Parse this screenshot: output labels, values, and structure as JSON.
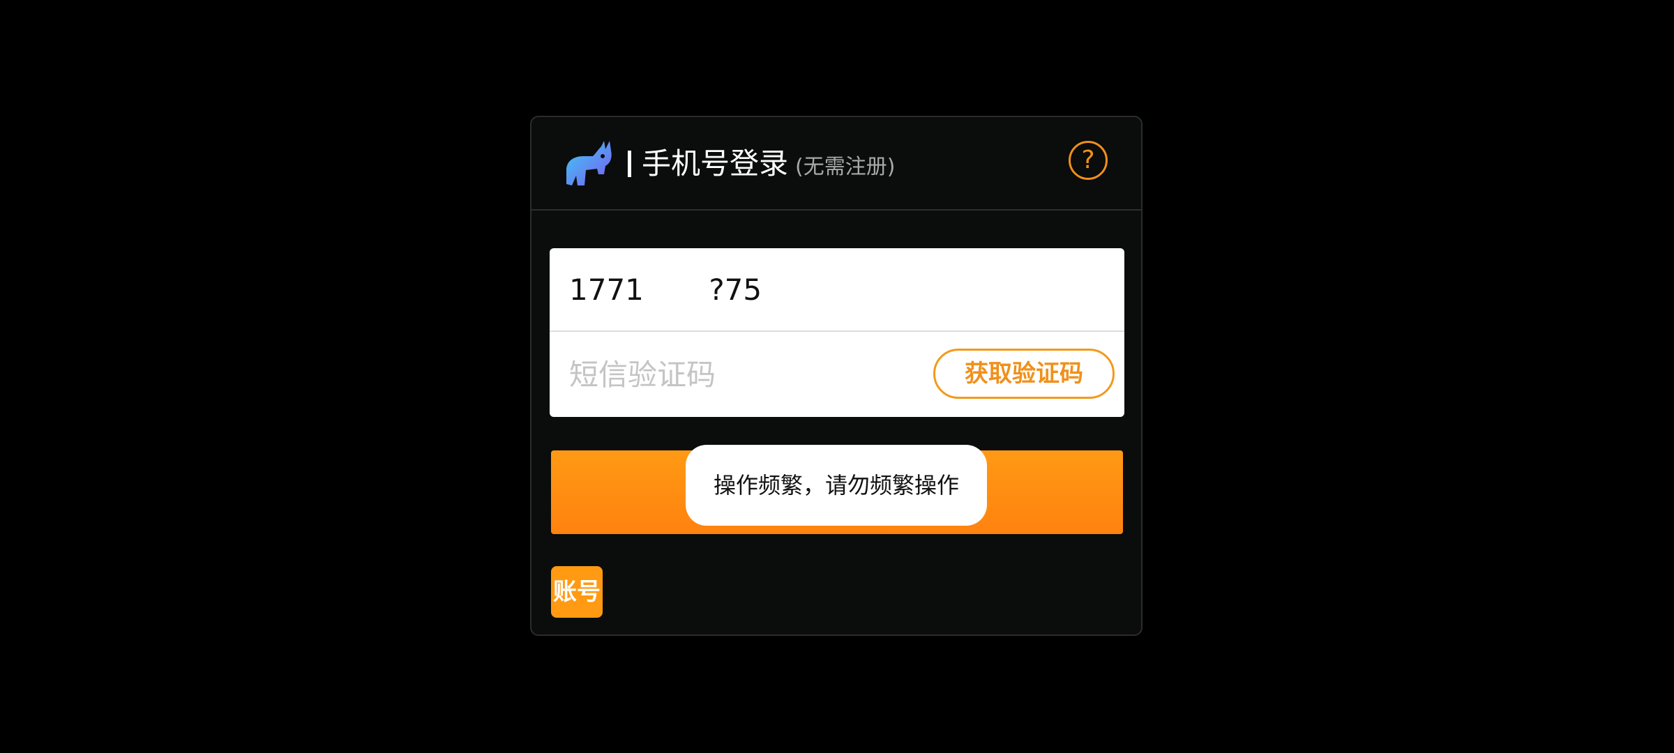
{
  "dialog": {
    "title": "手机号登录",
    "subtitle": "(无需注册)",
    "help_icon": "question-circle-icon",
    "logo_icon": "rhino-logo-icon"
  },
  "form": {
    "phone_value": "1771       ?75",
    "code_placeholder": "短信验证码",
    "get_code_label": "获取验证码"
  },
  "login_button": {
    "label": ""
  },
  "toast": {
    "message": "操作频繁，请勿频繁操作"
  },
  "account_button": {
    "label": "账号"
  },
  "colors": {
    "accent": "#ff9212",
    "background": "#000000",
    "dialog_bg": "#0b0c0c"
  }
}
